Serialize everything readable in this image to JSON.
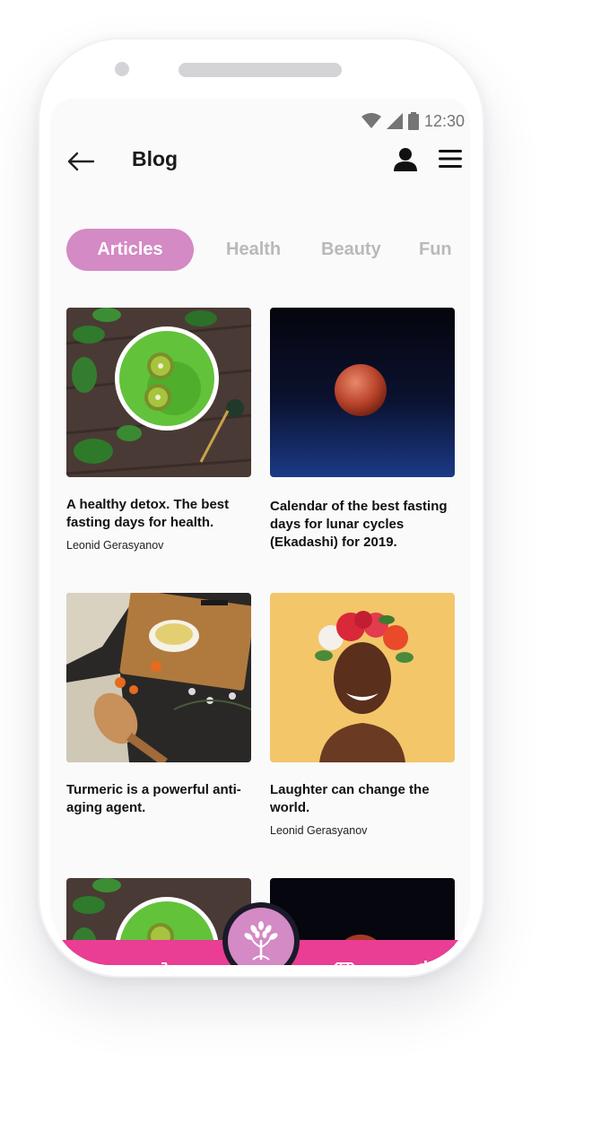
{
  "status": {
    "time": "12:30"
  },
  "header": {
    "title": "Blog"
  },
  "tabs": [
    {
      "label": "Articles",
      "active": true
    },
    {
      "label": "Health",
      "active": false
    },
    {
      "label": "Beauty",
      "active": false
    },
    {
      "label": "Fun",
      "active": false
    }
  ],
  "articles": [
    {
      "title": "A healthy detox. The best fasting days for health.",
      "author": "Leonid Gerasyanov",
      "image": "green-smoothie-bowl"
    },
    {
      "title": "Calendar of the best fasting days for lunar cycles (Ekadashi) for 2019.",
      "author": "",
      "image": "red-moon"
    },
    {
      "title": "Turmeric is a powerful anti-aging agent.",
      "author": "",
      "image": "turmeric-spices"
    },
    {
      "title": "Laughter can change the world.",
      "author": "Leonid Gerasyanov",
      "image": "woman-flower-crown"
    }
  ],
  "bottom_nav": {
    "items": [
      "lotus-icon",
      "cart-icon",
      "tree-logo-icon",
      "diamond-icon",
      "calendar-icon"
    ]
  },
  "colors": {
    "accent": "#ea3d94",
    "tab_active": "#d48ac4",
    "tab_inactive": "#b9b9b9"
  }
}
